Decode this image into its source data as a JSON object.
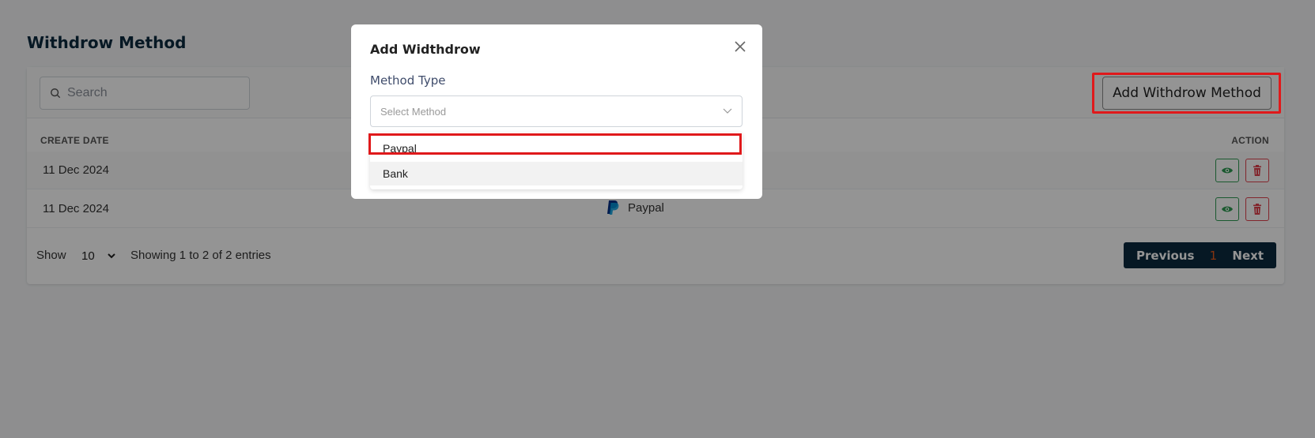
{
  "page": {
    "title": "Withdrow Method"
  },
  "toolbar": {
    "search_placeholder": "Search",
    "add_button_label": "Add Withdrow Method"
  },
  "table": {
    "headers": {
      "create_date": "CREATE DATE",
      "action": "ACTION"
    },
    "rows": [
      {
        "date": "11 Dec 2024",
        "method": ""
      },
      {
        "date": "11 Dec 2024",
        "method": "Paypal"
      }
    ]
  },
  "footer": {
    "show_label": "Show",
    "page_size": "10",
    "entries_text": "Showing 1 to 2 of 2 entries",
    "previous_label": "Previous",
    "current_page": "1",
    "next_label": "Next"
  },
  "modal": {
    "title": "Add Widthdrow",
    "method_type_label": "Method Type",
    "select_placeholder": "Select Method",
    "options": [
      "Paypal",
      "Bank"
    ]
  },
  "colors": {
    "brand_dark": "#0c2a3f",
    "highlight": "#e0191b",
    "view_green": "#2e9a52",
    "delete_red": "#e0414c",
    "current_page": "#e55a1c"
  },
  "icons": {
    "search": "search-icon",
    "paypal": "paypal-icon",
    "view": "eye-icon",
    "delete": "trash-icon",
    "close": "close-icon",
    "dropdown": "chevron-down-icon"
  }
}
